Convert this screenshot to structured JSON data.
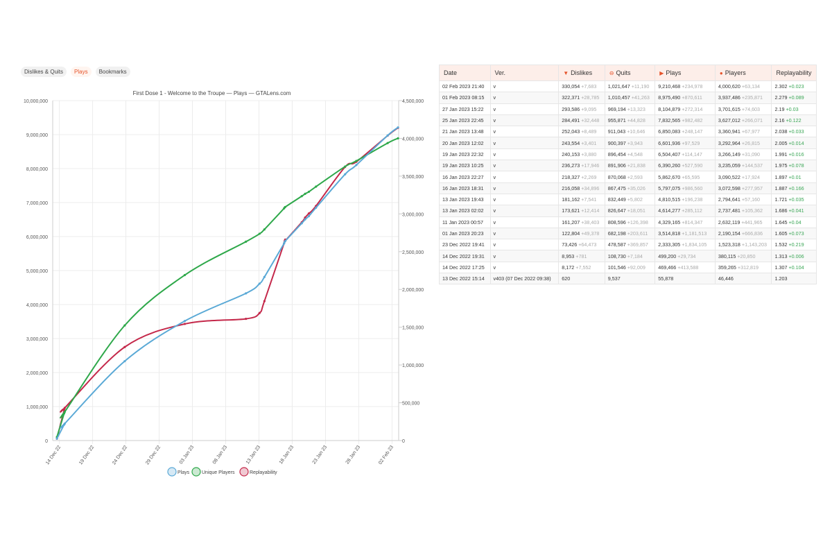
{
  "tabs": [
    {
      "label": "Dislikes & Quits",
      "active": false
    },
    {
      "label": "Plays",
      "active": true
    },
    {
      "label": "Bookmarks",
      "active": false
    }
  ],
  "table": {
    "headers": [
      {
        "label": "Date",
        "icon": ""
      },
      {
        "label": "Ver.",
        "icon": ""
      },
      {
        "label": "Dislikes",
        "icon": "thumbs-down-icon"
      },
      {
        "label": "Quits",
        "icon": "quit-icon"
      },
      {
        "label": "Plays",
        "icon": "gamepad-icon"
      },
      {
        "label": "Players",
        "icon": "user-icon"
      },
      {
        "label": "Replayability",
        "icon": ""
      }
    ],
    "rows": [
      {
        "date": "02 Feb 2023 21:40",
        "ver": "v",
        "dislikes": "330,054",
        "dislikes_d": "+7,683",
        "quits": "1,021,647",
        "quits_d": "+11,190",
        "plays": "9,210,468",
        "plays_d": "+234,978",
        "players": "4,000,620",
        "players_d": "+63,134",
        "rep": "2.302",
        "rep_d": "+0.023"
      },
      {
        "date": "01 Feb 2023 08:15",
        "ver": "v",
        "dislikes": "322,371",
        "dislikes_d": "+28,785",
        "quits": "1,010,457",
        "quits_d": "+41,263",
        "plays": "8,975,490",
        "plays_d": "+870,611",
        "players": "3,937,486",
        "players_d": "+235,871",
        "rep": "2.279",
        "rep_d": "+0.089"
      },
      {
        "date": "27 Jan 2023 15:22",
        "ver": "v",
        "dislikes": "293,586",
        "dislikes_d": "+9,095",
        "quits": "969,194",
        "quits_d": "+13,323",
        "plays": "8,104,879",
        "plays_d": "+272,314",
        "players": "3,701,615",
        "players_d": "+74,603",
        "rep": "2.19",
        "rep_d": "+0.03"
      },
      {
        "date": "25 Jan 2023 22:45",
        "ver": "v",
        "dislikes": "284,491",
        "dislikes_d": "+32,448",
        "quits": "955,871",
        "quits_d": "+44,828",
        "plays": "7,832,565",
        "plays_d": "+982,482",
        "players": "3,627,012",
        "players_d": "+266,071",
        "rep": "2.16",
        "rep_d": "+0.122"
      },
      {
        "date": "21 Jan 2023 13:48",
        "ver": "v",
        "dislikes": "252,043",
        "dislikes_d": "+8,489",
        "quits": "911,043",
        "quits_d": "+10,646",
        "plays": "6,850,083",
        "plays_d": "+248,147",
        "players": "3,360,941",
        "players_d": "+67,977",
        "rep": "2.038",
        "rep_d": "+0.033"
      },
      {
        "date": "20 Jan 2023 12:02",
        "ver": "v",
        "dislikes": "243,554",
        "dislikes_d": "+3,401",
        "quits": "900,397",
        "quits_d": "+3,943",
        "plays": "6,601,936",
        "plays_d": "+97,529",
        "players": "3,292,964",
        "players_d": "+26,815",
        "rep": "2.005",
        "rep_d": "+0.014"
      },
      {
        "date": "19 Jan 2023 22:32",
        "ver": "v",
        "dislikes": "240,153",
        "dislikes_d": "+3,880",
        "quits": "896,454",
        "quits_d": "+4,548",
        "plays": "6,504,407",
        "plays_d": "+114,147",
        "players": "3,266,149",
        "players_d": "+31,090",
        "rep": "1.991",
        "rep_d": "+0.016"
      },
      {
        "date": "19 Jan 2023 10:25",
        "ver": "v",
        "dislikes": "236,273",
        "dislikes_d": "+17,946",
        "quits": "891,906",
        "quits_d": "+21,838",
        "plays": "6,390,260",
        "plays_d": "+527,590",
        "players": "3,235,059",
        "players_d": "+144,537",
        "rep": "1.975",
        "rep_d": "+0.078"
      },
      {
        "date": "16 Jan 2023 22:27",
        "ver": "v",
        "dislikes": "218,327",
        "dislikes_d": "+2,269",
        "quits": "870,068",
        "quits_d": "+2,593",
        "plays": "5,862,670",
        "plays_d": "+65,595",
        "players": "3,090,522",
        "players_d": "+17,924",
        "rep": "1.897",
        "rep_d": "+0.01"
      },
      {
        "date": "16 Jan 2023 18:31",
        "ver": "v",
        "dislikes": "216,058",
        "dislikes_d": "+34,896",
        "quits": "867,475",
        "quits_d": "+35,026",
        "plays": "5,797,075",
        "plays_d": "+986,560",
        "players": "3,072,598",
        "players_d": "+277,957",
        "rep": "1.887",
        "rep_d": "+0.166"
      },
      {
        "date": "13 Jan 2023 19:43",
        "ver": "v",
        "dislikes": "181,162",
        "dislikes_d": "+7,541",
        "quits": "832,449",
        "quits_d": "+5,802",
        "plays": "4,810,515",
        "plays_d": "+196,238",
        "players": "2,794,641",
        "players_d": "+57,160",
        "rep": "1.721",
        "rep_d": "+0.035"
      },
      {
        "date": "13 Jan 2023 02:02",
        "ver": "v",
        "dislikes": "173,621",
        "dislikes_d": "+12,414",
        "quits": "826,647",
        "quits_d": "+18,051",
        "plays": "4,614,277",
        "plays_d": "+285,112",
        "players": "2,737,481",
        "players_d": "+105,362",
        "rep": "1.686",
        "rep_d": "+0.041"
      },
      {
        "date": "11 Jan 2023 00:57",
        "ver": "v",
        "dislikes": "161,207",
        "dislikes_d": "+38,403",
        "quits": "808,596",
        "quits_d": "+126,398",
        "plays": "4,329,165",
        "plays_d": "+814,347",
        "players": "2,632,119",
        "players_d": "+441,965",
        "rep": "1.645",
        "rep_d": "+0.04"
      },
      {
        "date": "01 Jan 2023 20:23",
        "ver": "v",
        "dislikes": "122,804",
        "dislikes_d": "+49,378",
        "quits": "682,198",
        "quits_d": "+203,611",
        "plays": "3,514,818",
        "plays_d": "+1,181,513",
        "players": "2,190,154",
        "players_d": "+666,836",
        "rep": "1.605",
        "rep_d": "+0.073"
      },
      {
        "date": "23 Dec 2022 19:41",
        "ver": "v",
        "dislikes": "73,426",
        "dislikes_d": "+64,473",
        "quits": "478,587",
        "quits_d": "+369,857",
        "plays": "2,333,305",
        "plays_d": "+1,834,105",
        "players": "1,523,318",
        "players_d": "+1,143,203",
        "rep": "1.532",
        "rep_d": "+0.219"
      },
      {
        "date": "14 Dec 2022 19:31",
        "ver": "v",
        "dislikes": "8,953",
        "dislikes_d": "+781",
        "quits": "108,730",
        "quits_d": "+7,184",
        "plays": "499,200",
        "plays_d": "+29,734",
        "players": "380,115",
        "players_d": "+20,850",
        "rep": "1.313",
        "rep_d": "+0.006"
      },
      {
        "date": "14 Dec 2022 17:25",
        "ver": "v",
        "dislikes": "8,172",
        "dislikes_d": "+7,552",
        "quits": "101,546",
        "quits_d": "+92,009",
        "plays": "469,466",
        "plays_d": "+413,588",
        "players": "359,265",
        "players_d": "+312,819",
        "rep": "1.307",
        "rep_d": "+0.104"
      },
      {
        "date": "13 Dec 2022 15:14",
        "ver": "v403 (07 Dec 2022 09:38)",
        "dislikes": "620",
        "dislikes_d": "",
        "quits": "9,537",
        "quits_d": "",
        "plays": "55,878",
        "plays_d": "",
        "players": "46,446",
        "players_d": "",
        "rep": "1.203",
        "rep_d": ""
      }
    ]
  },
  "chart_data": {
    "type": "line",
    "title": "First Dose 1 - Welcome to the Troupe — Plays — GTALens.com",
    "x_ticks": [
      "14 Dec 22",
      "19 Dec 22",
      "24 Dec 22",
      "29 Dec 22",
      "03 Jan 23",
      "08 Jan 23",
      "13 Jan 23",
      "18 Jan 23",
      "23 Jan 23",
      "28 Jan 23",
      "02 Feb 23"
    ],
    "x_range": [
      "2022-12-13",
      "2023-02-03"
    ],
    "y_left": {
      "min": 0,
      "max": 10000000,
      "ticks": [
        "0",
        "1,000,000",
        "2,000,000",
        "3,000,000",
        "4,000,000",
        "5,000,000",
        "6,000,000",
        "7,000,000",
        "8,000,000",
        "9,000,000",
        "10,000,000"
      ]
    },
    "y_right": {
      "min": 0,
      "max": 4500000,
      "ticks": [
        "0",
        "500,000",
        "1,000,000",
        "1,500,000",
        "2,000,000",
        "2,500,000",
        "3,000,000",
        "3,500,000",
        "4,000,000",
        "4,500,000"
      ]
    },
    "grid": true,
    "legend_position": "bottom",
    "series": [
      {
        "name": "Plays",
        "axis": "left",
        "color": "#5aa9d6",
        "x": [
          "2022-12-13 15:14",
          "2022-12-14 17:25",
          "2022-12-14 19:31",
          "2022-12-23 19:41",
          "2023-01-01 20:23",
          "2023-01-11 00:57",
          "2023-01-13 02:02",
          "2023-01-13 19:43",
          "2023-01-16 18:31",
          "2023-01-16 22:27",
          "2023-01-19 10:25",
          "2023-01-19 22:32",
          "2023-01-20 12:02",
          "2023-01-21 13:48",
          "2023-01-25 22:45",
          "2023-01-27 15:22",
          "2023-02-01 08:15",
          "2023-02-02 21:40"
        ],
        "y": [
          55878,
          469466,
          499200,
          2333305,
          3514818,
          4329165,
          4614277,
          4810515,
          5797075,
          5862670,
          6390260,
          6504407,
          6601936,
          6850083,
          7832565,
          8104879,
          8975490,
          9210468
        ]
      },
      {
        "name": "Unique Players",
        "axis": "right",
        "color": "#2ea84a",
        "x": [
          "2022-12-13 15:14",
          "2022-12-14 17:25",
          "2022-12-14 19:31",
          "2022-12-23 19:41",
          "2023-01-01 20:23",
          "2023-01-11 00:57",
          "2023-01-13 02:02",
          "2023-01-13 19:43",
          "2023-01-16 18:31",
          "2023-01-16 22:27",
          "2023-01-19 10:25",
          "2023-01-19 22:32",
          "2023-01-20 12:02",
          "2023-01-21 13:48",
          "2023-01-25 22:45",
          "2023-01-27 15:22",
          "2023-02-01 08:15",
          "2023-02-02 21:40"
        ],
        "y": [
          46446,
          359265,
          380115,
          1523318,
          2190154,
          2632119,
          2737481,
          2794641,
          3072598,
          3090522,
          3235059,
          3266149,
          3292964,
          3360941,
          3627012,
          3701615,
          3937486,
          4000620
        ]
      },
      {
        "name": "Replayability",
        "axis": "left",
        "color": "#c4284a",
        "x": [
          "2022-12-13 15:14",
          "2022-12-14 17:25",
          "2022-12-14 19:31",
          "2022-12-23 19:41",
          "2023-01-01 20:23",
          "2023-01-11 00:57",
          "2023-01-13 02:02",
          "2023-01-13 19:43",
          "2023-01-16 18:31",
          "2023-01-16 22:27",
          "2023-01-19 10:25",
          "2023-01-19 22:32",
          "2023-01-20 12:02",
          "2023-01-21 13:48",
          "2023-01-25 22:45",
          "2023-01-27 15:22",
          "2023-02-01 08:15",
          "2023-02-02 21:40"
        ],
        "y": [
          55878,
          900000,
          960000,
          2750000,
          3430000,
          3580000,
          3750000,
          4100000,
          5800000,
          5870000,
          6420000,
          6560000,
          6680000,
          6900000,
          8050000,
          8200000,
          8970000,
          9200000
        ]
      }
    ]
  }
}
